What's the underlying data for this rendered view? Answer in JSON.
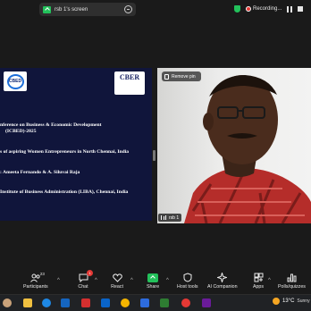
{
  "share_bar": {
    "label": "rsb 1's screen"
  },
  "recording": {
    "label": "Recording..."
  },
  "slide": {
    "logo_left_text": "CBED",
    "logo_right_text": "CBER",
    "line1": "nference on Business & Economic Development",
    "line2": "(ICBED)-2025",
    "line3": "s of aspiring Women Entrepreneurs in North Chennai, India",
    "line4": ":  Ameeta Fernando & A. Siluvai Raja",
    "line5": "Institute of Business Administration (LIBA), Chennai, India"
  },
  "video": {
    "remove_pin_label": "Remove pin",
    "participant_name": "rsb 1"
  },
  "toolbar": {
    "participants_label": "Participants",
    "participants_count": "23",
    "chat_label": "Chat",
    "chat_badge": "1",
    "react_label": "React",
    "share_label": "Share",
    "host_tools_label": "Host tools",
    "ai_companion_label": "AI Companion",
    "apps_label": "Apps",
    "polls_label": "Polls/quizzes"
  },
  "taskbar": {
    "temperature": "13°C",
    "weather": "Sunny"
  },
  "colors": {
    "slide_bg": "#10153b",
    "share_green": "#23c15b",
    "record_red": "#e53935",
    "shirt_red": "#b52d2a"
  }
}
